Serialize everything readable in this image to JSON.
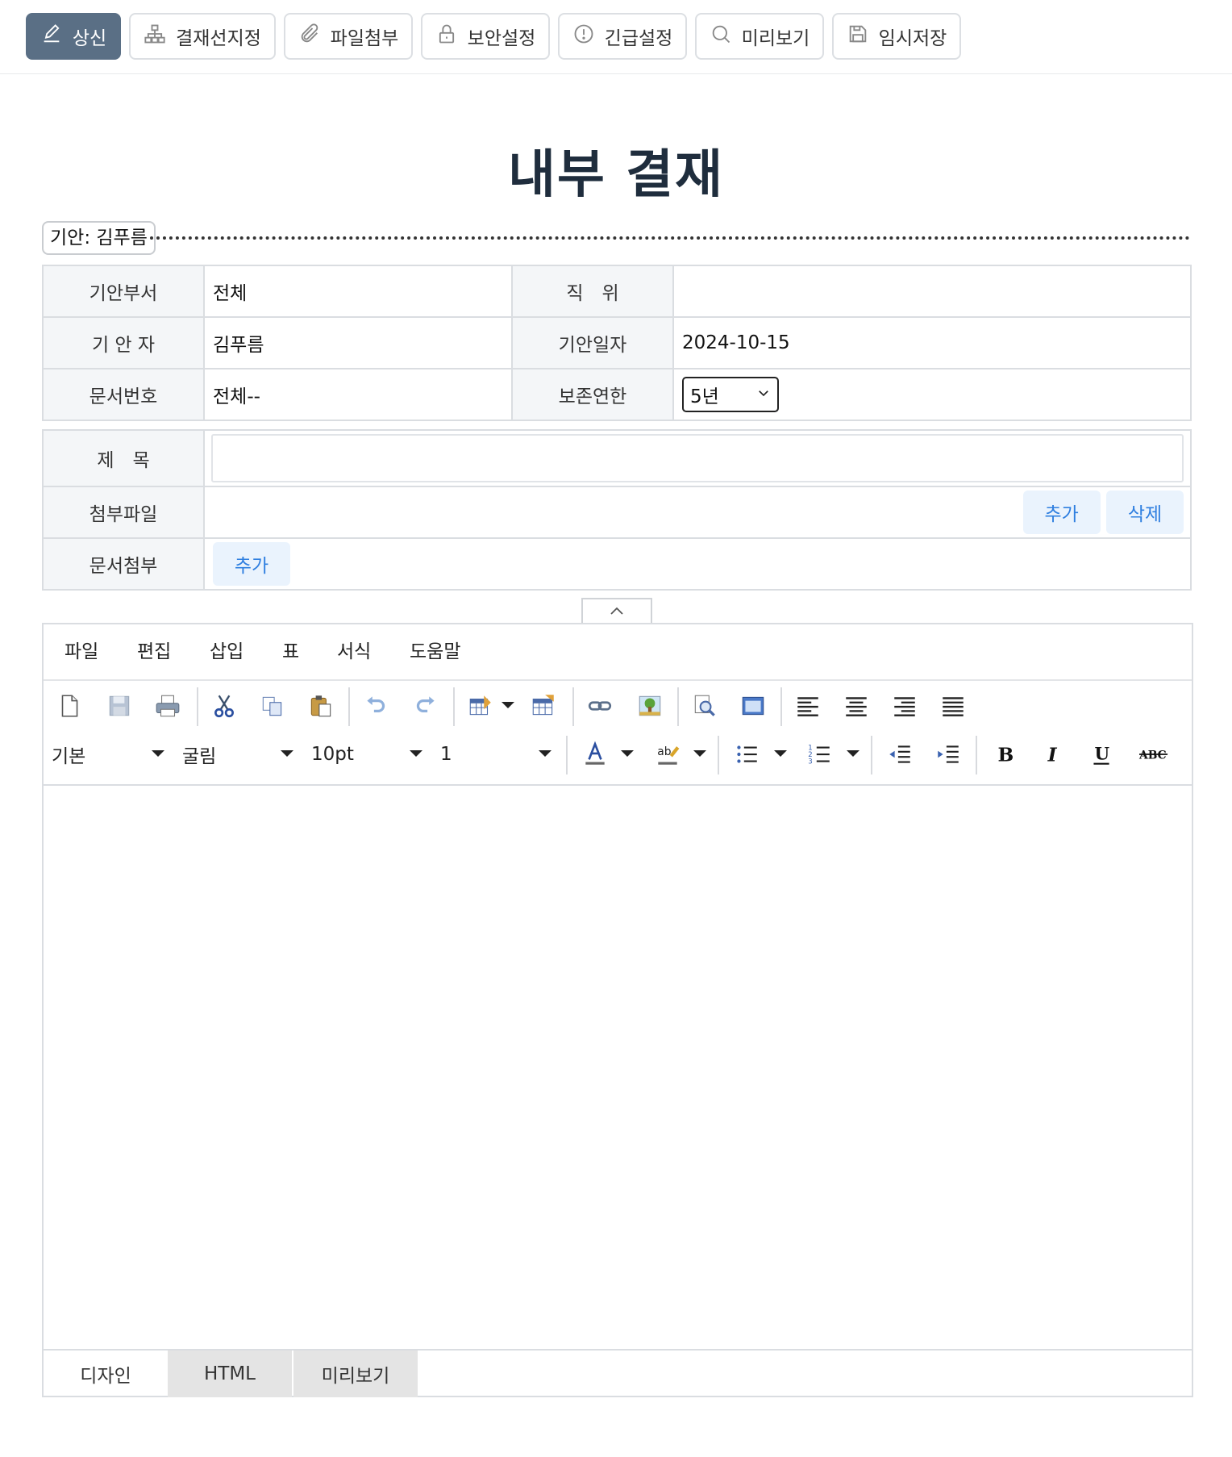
{
  "toolbar": {
    "buttons": [
      {
        "label": "상신",
        "icon": "pencil-icon"
      },
      {
        "label": "결재선지정",
        "icon": "org-chart-icon"
      },
      {
        "label": "파일첨부",
        "icon": "paperclip-icon"
      },
      {
        "label": "보안설정",
        "icon": "lock-icon"
      },
      {
        "label": "긴급설정",
        "icon": "alert-circle-icon"
      },
      {
        "label": "미리보기",
        "icon": "search-icon"
      },
      {
        "label": "임시저장",
        "icon": "save-icon"
      }
    ],
    "primary_color": "#5a6f85"
  },
  "document": {
    "title": "내부 결재",
    "drafter_tag": "기안: 김푸름"
  },
  "info": {
    "dept_label": "기안부서",
    "dept_value": "전체",
    "position_label": "직　위",
    "position_value": "",
    "drafter_label": "기 안 자",
    "drafter_value": "김푸름",
    "date_label": "기안일자",
    "date_value": "2024-10-15",
    "docno_label": "문서번호",
    "docno_value": "전체--",
    "retention_label": "보존연한",
    "retention_value": "5년"
  },
  "form": {
    "subject_label": "제　목",
    "subject_value": "",
    "attach_label": "첨부파일",
    "attach_add": "추가",
    "attach_delete": "삭제",
    "docattach_label": "문서첨부",
    "docattach_add": "추가",
    "link_color": "#2f7fe0"
  },
  "editor": {
    "menus": [
      "파일",
      "편집",
      "삽입",
      "표",
      "서식",
      "도움말"
    ],
    "paragraph_style": "기본",
    "font_family": "굴림",
    "font_size": "10pt",
    "line_height": "1",
    "tools_row1": [
      "new-document-icon",
      "save-disk-icon",
      "print-icon",
      "cut-icon",
      "copy-icon",
      "paste-icon",
      "undo-icon",
      "redo-icon",
      "insert-table-icon",
      "table-properties-icon",
      "link-icon",
      "image-icon",
      "find-icon",
      "fullscreen-icon",
      "align-left-icon",
      "align-center-icon",
      "align-right-icon",
      "align-justify-icon"
    ],
    "tools_row2": [
      "font-color-icon",
      "highlight-color-icon",
      "bullet-list-icon",
      "numbered-list-icon",
      "outdent-icon",
      "indent-icon",
      "bold-icon",
      "italic-icon",
      "underline-icon",
      "strikethrough-icon"
    ],
    "tabs": [
      "디자인",
      "HTML",
      "미리보기"
    ]
  }
}
